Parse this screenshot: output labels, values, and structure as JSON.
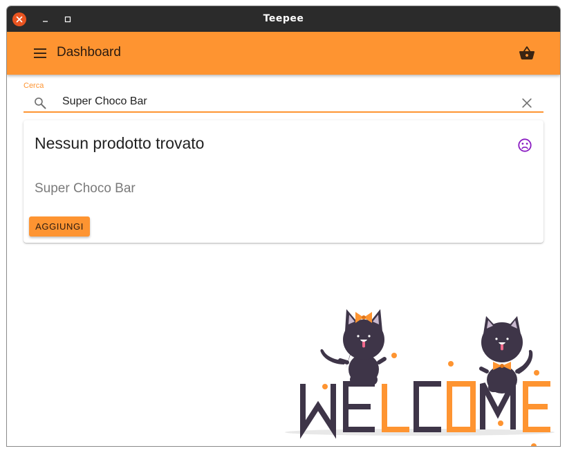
{
  "window": {
    "title": "Teepee"
  },
  "appbar": {
    "title": "Dashboard",
    "menu_icon": "menu-icon",
    "cart_icon": "shopping-basket-icon"
  },
  "search": {
    "label": "Cerca",
    "value": "Super Choco Bar",
    "icon": "search-icon",
    "clear_icon": "close-icon"
  },
  "result_card": {
    "title": "Nessun prodotto trovato",
    "product_name": "Super Choco Bar",
    "add_button": "AGGIUNGI",
    "icon": "sad-face-icon"
  },
  "illustration": {
    "text": "WELCOME"
  },
  "colors": {
    "accent": "#fe9431",
    "titlebar": "#2b2b2b",
    "close": "#e95420",
    "sad_icon": "#8a1cc2",
    "cat": "#3e3548"
  }
}
